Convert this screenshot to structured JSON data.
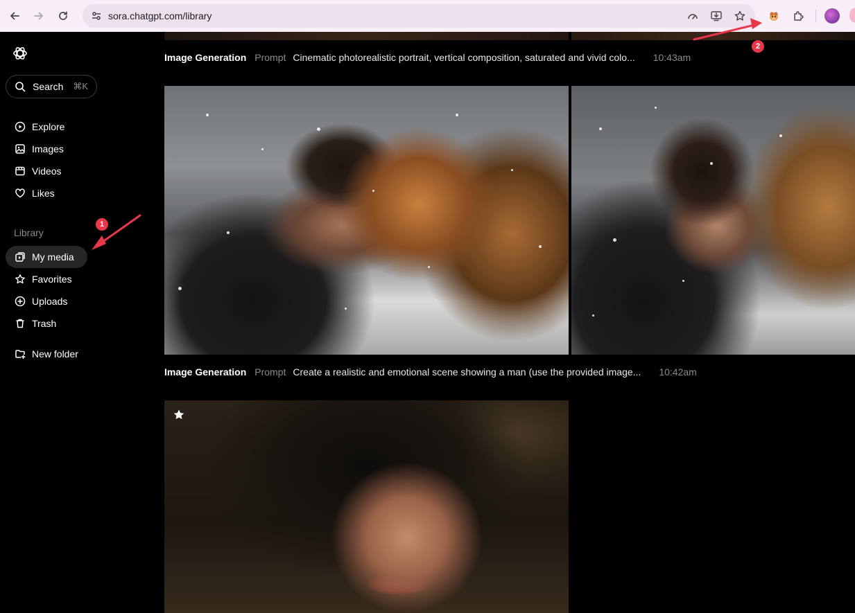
{
  "browser": {
    "url": "sora.chatgpt.com/library",
    "icons": [
      "back-icon",
      "forward-icon",
      "reload-icon",
      "site-settings-icon",
      "performance-icon",
      "install-app-icon",
      "bookmark-star-icon",
      "extension-icon",
      "puzzle-icon",
      "profile-avatar"
    ]
  },
  "sidebar": {
    "search": {
      "label": "Search",
      "shortcut": "⌘K"
    },
    "nav": [
      {
        "label": "Explore",
        "icon": "play-circle-icon"
      },
      {
        "label": "Images",
        "icon": "image-icon"
      },
      {
        "label": "Videos",
        "icon": "video-icon"
      },
      {
        "label": "Likes",
        "icon": "heart-icon"
      }
    ],
    "library_label": "Library",
    "library": [
      {
        "label": "My media",
        "icon": "media-icon",
        "active": true
      },
      {
        "label": "Favorites",
        "icon": "star-icon"
      },
      {
        "label": "Uploads",
        "icon": "plus-circle-icon"
      },
      {
        "label": "Trash",
        "icon": "trash-icon"
      }
    ],
    "new_folder": {
      "label": "New folder",
      "icon": "folder-plus-icon"
    }
  },
  "feed": [
    {
      "type": "Image Generation",
      "prompt_key": "Prompt",
      "prompt": "Cinematic photorealistic portrait, vertical composition, saturated and vivid colo...",
      "time": "10:43am"
    },
    {
      "type": "Image Generation",
      "prompt_key": "Prompt",
      "prompt": "Create a realistic and emotional scene showing a man (use the provided image...",
      "time": "10:42am"
    }
  ],
  "annotations": [
    {
      "number": "1"
    },
    {
      "number": "2"
    }
  ],
  "colors": {
    "accent_red": "#e8364a",
    "chrome_bg": "#f7eef7",
    "app_bg": "#000000",
    "muted_text": "#8a8a8a"
  }
}
